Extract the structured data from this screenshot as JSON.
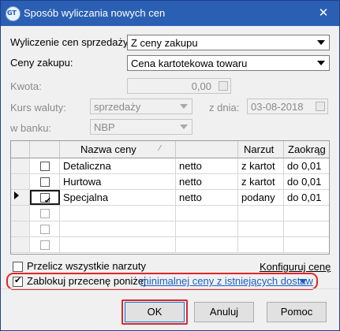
{
  "window": {
    "title": "Sposób wyliczania nowych cen",
    "app_icon_text": "GT",
    "close_glyph": "✕"
  },
  "form": {
    "wyliczenie": {
      "label": "Wyliczenie cen sprzedaży:",
      "value": "Z ceny zakupu"
    },
    "ceny_zakupu": {
      "label": "Ceny zakupu:",
      "value": "Cena kartotekowa towaru"
    },
    "kwota": {
      "label": "Kwota:",
      "value": "0,00"
    },
    "kurs": {
      "label": "Kurs waluty:",
      "value": "sprzedaży"
    },
    "data": {
      "label": "z dnia:",
      "value": "03-08-2018"
    },
    "bank": {
      "label": "w banku:",
      "value": "NBP"
    }
  },
  "grid": {
    "headers": {
      "col_name": "Nazwa ceny",
      "col_type": "",
      "col_narzut": "Narzut",
      "col_zaokr": "Zaokrąg"
    },
    "sort_glyph": "⁄",
    "rows": [
      {
        "checked": false,
        "name": "Detaliczna",
        "type": "netto",
        "narzut": "z kartot",
        "zaokr": "do 0,01"
      },
      {
        "checked": false,
        "name": "Hurtowa",
        "type": "netto",
        "narzut": "z kartot",
        "zaokr": "do 0,01"
      },
      {
        "checked": true,
        "current": true,
        "name": "Specjalna",
        "type": "netto",
        "narzut": "podany",
        "zaokr": "do 0,01"
      },
      {
        "checked": false,
        "name": "",
        "type": "",
        "narzut": "",
        "zaokr": ""
      },
      {
        "checked": false,
        "name": "",
        "type": "",
        "narzut": "",
        "zaokr": ""
      },
      {
        "checked": false,
        "name": "",
        "type": "",
        "narzut": "",
        "zaokr": ""
      }
    ]
  },
  "options": {
    "przelicz": {
      "label": "Przelicz wszystkie narzuty",
      "checked": false
    },
    "konfiguruj_link": "Konfiguruj cenę",
    "zablokuj": {
      "label": "Zablokuj przecenę poniżej",
      "checked": true,
      "link": "minimalnej ceny z istniejących dostaw"
    }
  },
  "buttons": {
    "ok": "OK",
    "anuluj": "Anuluj",
    "pomoc": "Pomoc"
  },
  "colors": {
    "title_bar": "#2b5fb3",
    "highlight": "#e0262a",
    "link_blue": "#1a5fc5"
  }
}
